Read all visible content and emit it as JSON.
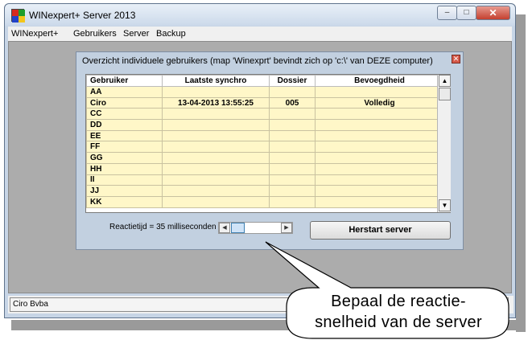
{
  "window": {
    "title": "WINexpert+ Server 2013",
    "btn_min": "–",
    "btn_max": "□",
    "btn_close": "✕"
  },
  "menu": [
    "WINexpert+",
    "Gebruikers",
    "Server",
    "Backup"
  ],
  "panel": {
    "title": "Overzicht individuele gebruikers (map 'Winexprt' bevindt zich op 'c:\\' van DEZE computer)",
    "close": "✕",
    "columns": [
      "Gebruiker",
      "Laatste synchro",
      "Dossier",
      "Bevoegdheid"
    ],
    "rows": [
      [
        "AA",
        "",
        "",
        ""
      ],
      [
        "Ciro",
        "13-04-2013  13:55:25",
        "005",
        "Volledig"
      ],
      [
        "CC",
        "",
        "",
        ""
      ],
      [
        "DD",
        "",
        "",
        ""
      ],
      [
        "EE",
        "",
        "",
        ""
      ],
      [
        "FF",
        "",
        "",
        ""
      ],
      [
        "GG",
        "",
        "",
        ""
      ],
      [
        "HH",
        "",
        "",
        ""
      ],
      [
        "II",
        "",
        "",
        ""
      ],
      [
        "JJ",
        "",
        "",
        ""
      ],
      [
        "KK",
        "",
        "",
        ""
      ]
    ],
    "speed_label": "Reactietijd = 35 milliseconden",
    "restart_button": "Herstart server"
  },
  "status": {
    "text": "Ciro Bvba"
  },
  "callout": {
    "line1": "Bepaal de reactie-",
    "line2": "snelheid van de server"
  },
  "colors": {
    "grid_row": "#fff7c8",
    "client_bg": "#acacac",
    "panel_bg": "#c2d0e0"
  }
}
